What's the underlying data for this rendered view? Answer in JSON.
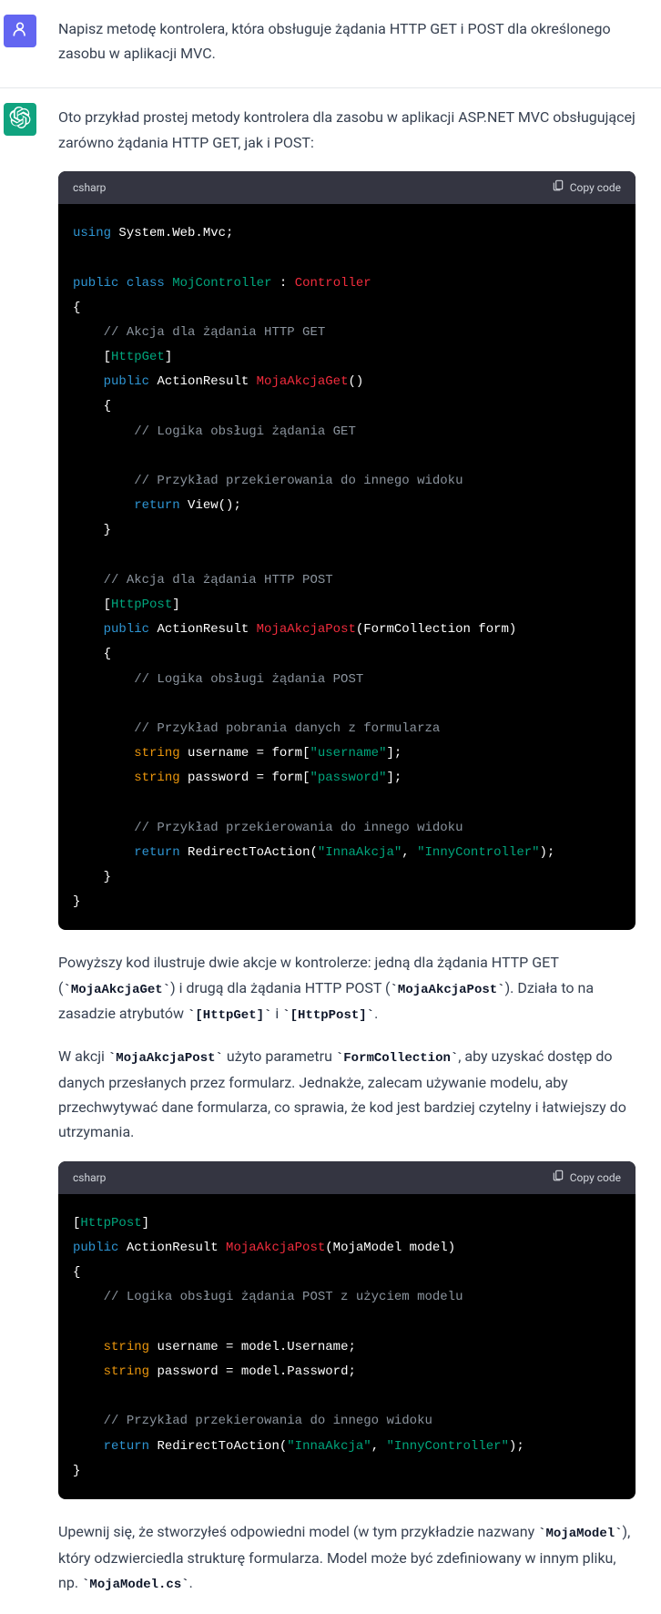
{
  "user": {
    "prompt": "Napisz metodę kontrolera, która obsługuje żądania HTTP GET i POST dla określonego zasobu w aplikacji MVC."
  },
  "assistant": {
    "intro": "Oto przykład prostej metody kontrolera dla zasobu w aplikacji ASP.NET MVC obsługującej zarówno żądania HTTP GET, jak i POST:",
    "code1_lang": "csharp",
    "copy_label": "Copy code",
    "code1_tokens": [
      [
        "kw",
        "using"
      ],
      [
        "w",
        " "
      ],
      [
        "p",
        "System.Web.Mvc;"
      ],
      [
        "nl",
        ""
      ],
      [
        "nl",
        ""
      ],
      [
        "kw",
        "public"
      ],
      [
        "w",
        " "
      ],
      [
        "kw",
        "class"
      ],
      [
        "w",
        " "
      ],
      [
        "cls",
        "MojController"
      ],
      [
        "w",
        " "
      ],
      [
        "p",
        ":"
      ],
      [
        "w",
        " "
      ],
      [
        "type",
        "Controller"
      ],
      [
        "nl",
        ""
      ],
      [
        "p",
        "{"
      ],
      [
        "nl",
        ""
      ],
      [
        "w",
        "    "
      ],
      [
        "com",
        "// Akcja dla żądania HTTP GET"
      ],
      [
        "nl",
        ""
      ],
      [
        "w",
        "    "
      ],
      [
        "p",
        "["
      ],
      [
        "cls",
        "HttpGet"
      ],
      [
        "p",
        "]"
      ],
      [
        "nl",
        ""
      ],
      [
        "w",
        "    "
      ],
      [
        "kw",
        "public"
      ],
      [
        "w",
        " "
      ],
      [
        "p",
        "ActionResult "
      ],
      [
        "fn",
        "MojaAkcjaGet"
      ],
      [
        "p",
        "()"
      ],
      [
        "nl",
        ""
      ],
      [
        "w",
        "    "
      ],
      [
        "p",
        "{"
      ],
      [
        "nl",
        ""
      ],
      [
        "w",
        "        "
      ],
      [
        "com",
        "// Logika obsługi żądania GET"
      ],
      [
        "nl",
        ""
      ],
      [
        "nl",
        ""
      ],
      [
        "w",
        "        "
      ],
      [
        "com",
        "// Przykład przekierowania do innego widoku"
      ],
      [
        "nl",
        ""
      ],
      [
        "w",
        "        "
      ],
      [
        "kw",
        "return"
      ],
      [
        "w",
        " "
      ],
      [
        "p",
        "View();"
      ],
      [
        "nl",
        ""
      ],
      [
        "w",
        "    "
      ],
      [
        "p",
        "}"
      ],
      [
        "nl",
        ""
      ],
      [
        "nl",
        ""
      ],
      [
        "w",
        "    "
      ],
      [
        "com",
        "// Akcja dla żądania HTTP POST"
      ],
      [
        "nl",
        ""
      ],
      [
        "w",
        "    "
      ],
      [
        "p",
        "["
      ],
      [
        "cls",
        "HttpPost"
      ],
      [
        "p",
        "]"
      ],
      [
        "nl",
        ""
      ],
      [
        "w",
        "    "
      ],
      [
        "kw",
        "public"
      ],
      [
        "w",
        " "
      ],
      [
        "p",
        "ActionResult "
      ],
      [
        "fn",
        "MojaAkcjaPost"
      ],
      [
        "p",
        "("
      ],
      [
        "p",
        "FormCollection form"
      ],
      [
        "p",
        ")"
      ],
      [
        "nl",
        ""
      ],
      [
        "w",
        "    "
      ],
      [
        "p",
        "{"
      ],
      [
        "nl",
        ""
      ],
      [
        "w",
        "        "
      ],
      [
        "com",
        "// Logika obsługi żądania POST"
      ],
      [
        "nl",
        ""
      ],
      [
        "nl",
        ""
      ],
      [
        "w",
        "        "
      ],
      [
        "com",
        "// Przykład pobrania danych z formularza"
      ],
      [
        "nl",
        ""
      ],
      [
        "w",
        "        "
      ],
      [
        "attr",
        "string"
      ],
      [
        "w",
        " "
      ],
      [
        "p",
        "username = form["
      ],
      [
        "str",
        "\"username\""
      ],
      [
        "p",
        "];"
      ],
      [
        "nl",
        ""
      ],
      [
        "w",
        "        "
      ],
      [
        "attr",
        "string"
      ],
      [
        "w",
        " "
      ],
      [
        "p",
        "password = form["
      ],
      [
        "str",
        "\"password\""
      ],
      [
        "p",
        "];"
      ],
      [
        "nl",
        ""
      ],
      [
        "nl",
        ""
      ],
      [
        "w",
        "        "
      ],
      [
        "com",
        "// Przykład przekierowania do innego widoku"
      ],
      [
        "nl",
        ""
      ],
      [
        "w",
        "        "
      ],
      [
        "kw",
        "return"
      ],
      [
        "w",
        " "
      ],
      [
        "p",
        "RedirectToAction("
      ],
      [
        "str",
        "\"InnaAkcja\""
      ],
      [
        "p",
        ", "
      ],
      [
        "str",
        "\"InnyController\""
      ],
      [
        "p",
        ");"
      ],
      [
        "nl",
        ""
      ],
      [
        "w",
        "    "
      ],
      [
        "p",
        "}"
      ],
      [
        "nl",
        ""
      ],
      [
        "p",
        "}"
      ]
    ],
    "p2_parts": [
      {
        "t": "text",
        "v": "Powyższy kod ilustruje dwie akcje w kontrolerze: jedną dla żądania HTTP GET ("
      },
      {
        "t": "code",
        "v": "`MojaAkcjaGet`"
      },
      {
        "t": "text",
        "v": ") i drugą dla żądania HTTP POST ("
      },
      {
        "t": "code",
        "v": "`MojaAkcjaPost`"
      },
      {
        "t": "text",
        "v": "). Działa to na zasadzie atrybutów "
      },
      {
        "t": "code",
        "v": "`[HttpGet]`"
      },
      {
        "t": "text",
        "v": " i "
      },
      {
        "t": "code",
        "v": "`[HttpPost]`"
      },
      {
        "t": "text",
        "v": "."
      }
    ],
    "p3_parts": [
      {
        "t": "text",
        "v": "W akcji "
      },
      {
        "t": "code",
        "v": "`MojaAkcjaPost`"
      },
      {
        "t": "text",
        "v": " użyto parametru "
      },
      {
        "t": "code",
        "v": "`FormCollection`"
      },
      {
        "t": "text",
        "v": ", aby uzyskać dostęp do danych przesłanych przez formularz. Jednakże, zalecam używanie modelu, aby przechwytywać dane formularza, co sprawia, że kod jest bardziej czytelny i łatwiejszy do utrzymania."
      }
    ],
    "code2_lang": "csharp",
    "code2_tokens": [
      [
        "p",
        "["
      ],
      [
        "cls",
        "HttpPost"
      ],
      [
        "p",
        "]"
      ],
      [
        "nl",
        ""
      ],
      [
        "kw",
        "public"
      ],
      [
        "w",
        " "
      ],
      [
        "p",
        "ActionResult "
      ],
      [
        "fn",
        "MojaAkcjaPost"
      ],
      [
        "p",
        "(MojaModel model)"
      ],
      [
        "nl",
        ""
      ],
      [
        "p",
        "{"
      ],
      [
        "nl",
        ""
      ],
      [
        "w",
        "    "
      ],
      [
        "com",
        "// Logika obsługi żądania POST z użyciem modelu"
      ],
      [
        "nl",
        ""
      ],
      [
        "nl",
        ""
      ],
      [
        "w",
        "    "
      ],
      [
        "attr",
        "string"
      ],
      [
        "w",
        " "
      ],
      [
        "p",
        "username = model.Username;"
      ],
      [
        "nl",
        ""
      ],
      [
        "w",
        "    "
      ],
      [
        "attr",
        "string"
      ],
      [
        "w",
        " "
      ],
      [
        "p",
        "password = model.Password;"
      ],
      [
        "nl",
        ""
      ],
      [
        "nl",
        ""
      ],
      [
        "w",
        "    "
      ],
      [
        "com",
        "// Przykład przekierowania do innego widoku"
      ],
      [
        "nl",
        ""
      ],
      [
        "w",
        "    "
      ],
      [
        "kw",
        "return"
      ],
      [
        "w",
        " "
      ],
      [
        "p",
        "RedirectToAction("
      ],
      [
        "str",
        "\"InnaAkcja\""
      ],
      [
        "p",
        ", "
      ],
      [
        "str",
        "\"InnyController\""
      ],
      [
        "p",
        ");"
      ],
      [
        "nl",
        ""
      ],
      [
        "p",
        "}"
      ]
    ],
    "p4_parts": [
      {
        "t": "text",
        "v": "Upewnij się, że stworzyłeś odpowiedni model (w tym przykładzie nazwany "
      },
      {
        "t": "code",
        "v": "`MojaModel`"
      },
      {
        "t": "text",
        "v": "), który odzwierciedla strukturę formularza. Model może być zdefiniowany w innym pliku, np. "
      },
      {
        "t": "code",
        "v": "`MojaModel.cs`"
      },
      {
        "t": "text",
        "v": "."
      }
    ]
  }
}
